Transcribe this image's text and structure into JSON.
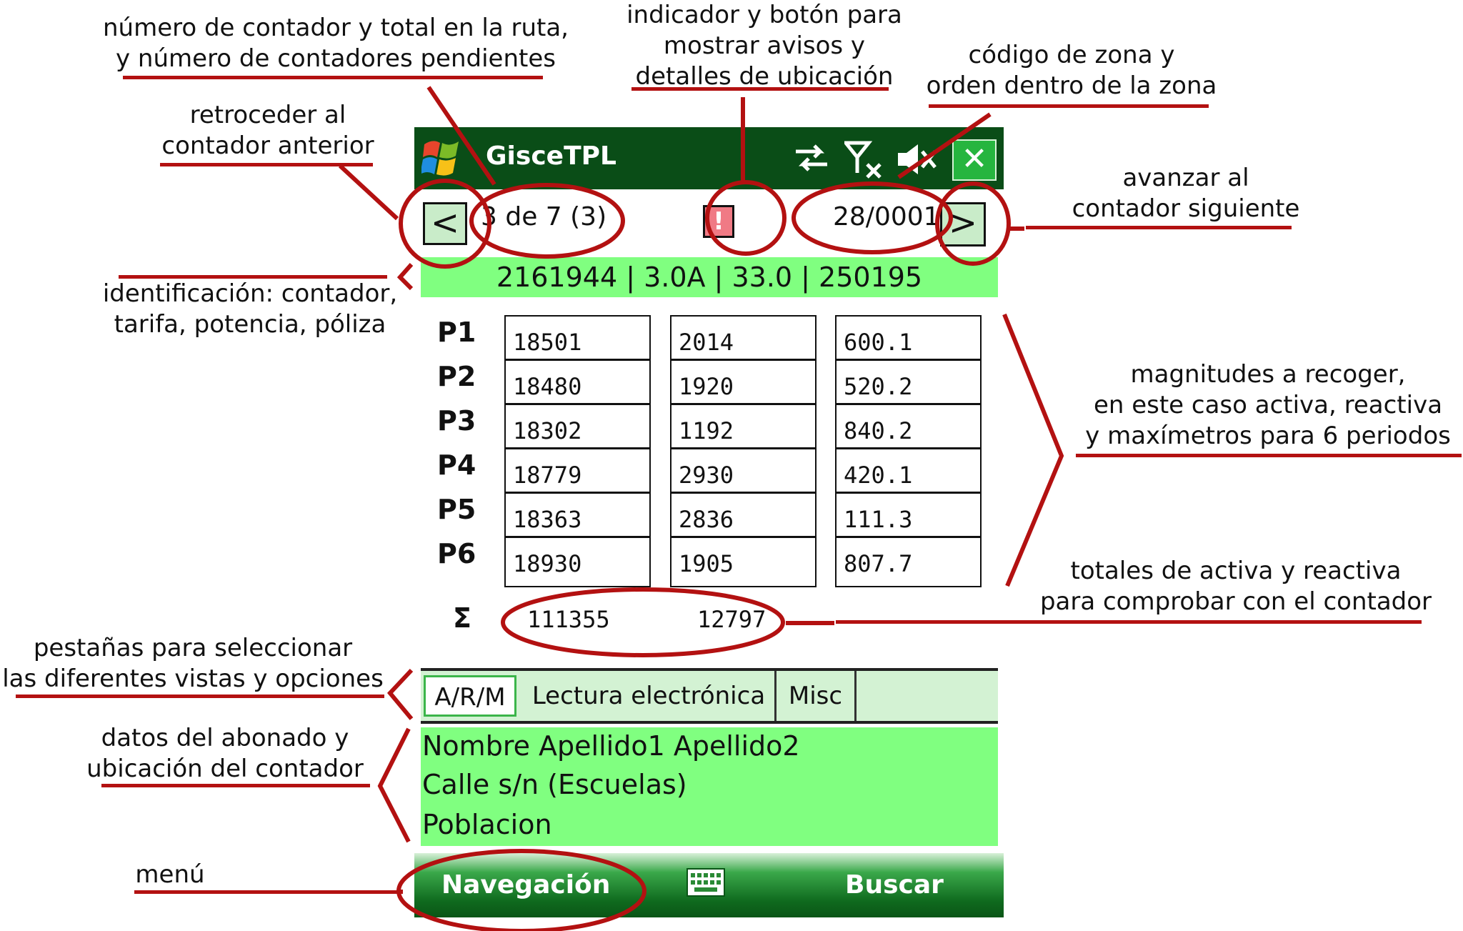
{
  "annotations": {
    "counter_info": [
      "número de contador y total en la ruta,",
      "y número de contadores pendientes"
    ],
    "alert_info": [
      "indicador y botón para",
      "mostrar avisos y",
      "detalles de ubicación"
    ],
    "zone_info": [
      "código de zona y",
      "orden dentro de la zona"
    ],
    "prev_info": [
      "retroceder al",
      "contador anterior"
    ],
    "next_info": [
      "avanzar al",
      "contador siguiente"
    ],
    "id_info": [
      "identificación: contador,",
      "tarifa, potencia, póliza"
    ],
    "magnitudes_info": [
      "magnitudes a recoger,",
      "en este caso activa, reactiva",
      "y maxímetros para 6 periodos"
    ],
    "totals_info": [
      "totales de activa y reactiva",
      "para comprobar con el contador"
    ],
    "tabs_info": [
      "pestañas para seleccionar",
      "las diferentes vistas y opciones"
    ],
    "subscriber_info": [
      "datos del abonado y",
      "ubicación del contador"
    ],
    "menu_info": [
      "menú"
    ]
  },
  "app": {
    "title": "GisceTPL",
    "icons": [
      "windows-logo-icon",
      "sync-arrows-icon",
      "no-signal-icon",
      "speaker-muted-icon",
      "close-icon"
    ],
    "close_label": "✕"
  },
  "nav": {
    "prev_label": "<",
    "counter": "3 de 7 (3)",
    "alert_label": "!",
    "zone_code": "28/0001",
    "next_label": ">"
  },
  "identification": "2161944 | 3.0A | 33.0 | 250195",
  "readings": {
    "periods": [
      "P1",
      "P2",
      "P3",
      "P4",
      "P5",
      "P6"
    ],
    "active": [
      "18501",
      "18480",
      "18302",
      "18779",
      "18363",
      "18930"
    ],
    "reactive": [
      "2014",
      "1920",
      "1192",
      "2930",
      "2836",
      "1905"
    ],
    "maximeter": [
      "600.1",
      "520.2",
      "840.2",
      "420.1",
      "111.3",
      "807.7"
    ],
    "sigma": "Σ",
    "total_active": "111355",
    "total_reactive": "12797"
  },
  "tabs": [
    "A/R/M",
    "Lectura electrónica",
    "Misc"
  ],
  "subscriber": {
    "name": "Nombre Apellido1 Apellido2",
    "address": "Calle s/n (Escuelas)",
    "town": "Poblacion"
  },
  "menu": {
    "left": "Navegación",
    "keyboard_icon": "keyboard-icon",
    "right": "Buscar"
  },
  "colors": {
    "annotation_red": "#b31111",
    "titlebar_green": "#0a4d17",
    "highlight_green": "#80ff80",
    "tab_green": "#d3f2d3",
    "alert_red": "#f07a85"
  }
}
